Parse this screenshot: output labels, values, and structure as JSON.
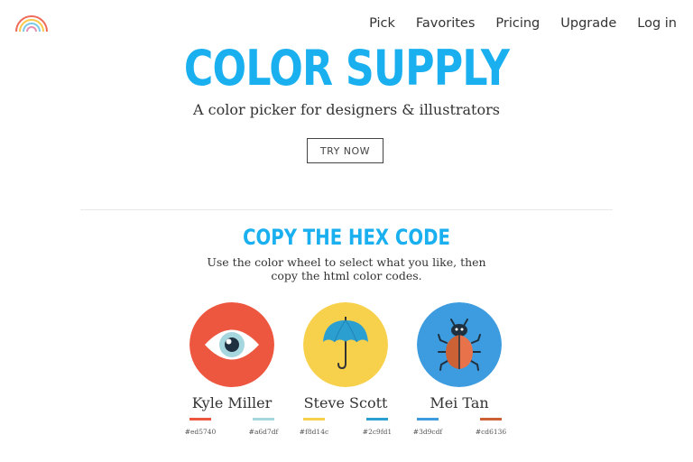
{
  "nav": {
    "items": [
      "Pick",
      "Favorites",
      "Pricing",
      "Upgrade",
      "Log in"
    ]
  },
  "hero": {
    "title": "COLOR SUPPLY",
    "subtitle": "A color picker for designers & illustrators",
    "button": "TRY NOW"
  },
  "section": {
    "title": "COPY THE HEX CODE",
    "desc_line1": "Use the color wheel to select what you like, then",
    "desc_line2": "copy the html color codes."
  },
  "cards": [
    {
      "name": "Kyle Miller",
      "icon": "eye-icon",
      "bg": "#ed5740",
      "swatches": [
        {
          "hex": "#ed5740",
          "color": "#ed5740"
        },
        {
          "hex": "#a6d7df",
          "color": "#a6d7df"
        }
      ]
    },
    {
      "name": "Steve Scott",
      "icon": "umbrella-icon",
      "bg": "#f8d14c",
      "swatches": [
        {
          "hex": "#f8d14c",
          "color": "#f8d14c"
        },
        {
          "hex": "#2c9fd1",
          "color": "#2c9fd1"
        }
      ]
    },
    {
      "name": "Mei Tan",
      "icon": "bug-icon",
      "bg": "#3d9cdf",
      "swatches": [
        {
          "hex": "#3d9cdf",
          "color": "#3d9cdf"
        },
        {
          "hex": "#cd6136",
          "color": "#cd6136"
        }
      ]
    }
  ],
  "colors": {
    "accent": "#1ab0f0"
  }
}
